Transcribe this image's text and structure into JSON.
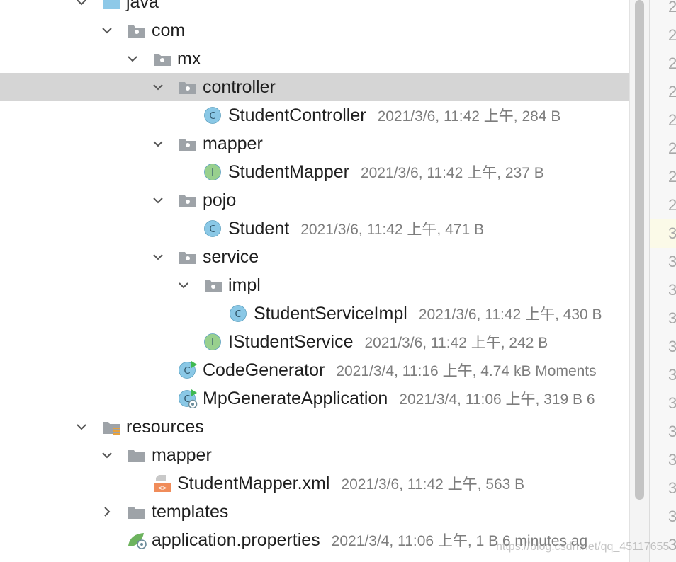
{
  "tree": {
    "rows": [
      {
        "name": "java",
        "meta": "",
        "kind": "folder-src",
        "arrow": "down",
        "depth": 0,
        "selected": false
      },
      {
        "name": "com",
        "meta": "",
        "kind": "package",
        "arrow": "down",
        "depth": 1,
        "selected": false
      },
      {
        "name": "mx",
        "meta": "",
        "kind": "package",
        "arrow": "down",
        "depth": 2,
        "selected": false
      },
      {
        "name": "controller",
        "meta": "",
        "kind": "package",
        "arrow": "down",
        "depth": 3,
        "selected": true
      },
      {
        "name": "StudentController",
        "meta": "2021/3/6, 11:42 上午, 284 B",
        "kind": "class",
        "arrow": "",
        "depth": 4,
        "selected": false
      },
      {
        "name": "mapper",
        "meta": "",
        "kind": "package",
        "arrow": "down",
        "depth": 3,
        "selected": false
      },
      {
        "name": "StudentMapper",
        "meta": "2021/3/6, 11:42 上午, 237 B",
        "kind": "interface",
        "arrow": "",
        "depth": 4,
        "selected": false
      },
      {
        "name": "pojo",
        "meta": "",
        "kind": "package",
        "arrow": "down",
        "depth": 3,
        "selected": false
      },
      {
        "name": "Student",
        "meta": "2021/3/6, 11:42 上午, 471 B",
        "kind": "class",
        "arrow": "",
        "depth": 4,
        "selected": false
      },
      {
        "name": "service",
        "meta": "",
        "kind": "package",
        "arrow": "down",
        "depth": 3,
        "selected": false
      },
      {
        "name": "impl",
        "meta": "",
        "kind": "package",
        "arrow": "down",
        "depth": 4,
        "selected": false
      },
      {
        "name": "StudentServiceImpl",
        "meta": "2021/3/6, 11:42 上午, 430 B",
        "kind": "class",
        "arrow": "",
        "depth": 5,
        "selected": false
      },
      {
        "name": "IStudentService",
        "meta": "2021/3/6, 11:42 上午, 242 B",
        "kind": "interface",
        "arrow": "",
        "depth": 4,
        "selected": false
      },
      {
        "name": "CodeGenerator",
        "meta": "2021/3/4, 11:16 上午, 4.74 kB Moments",
        "kind": "class-run",
        "arrow": "",
        "depth": 3,
        "selected": false
      },
      {
        "name": "MpGenerateApplication",
        "meta": "2021/3/4, 11:06 上午, 319 B 6",
        "kind": "class-spring",
        "arrow": "",
        "depth": 3,
        "selected": false
      },
      {
        "name": "resources",
        "meta": "",
        "kind": "folder-res",
        "arrow": "down",
        "depth": 0,
        "selected": false
      },
      {
        "name": "mapper",
        "meta": "",
        "kind": "folder",
        "arrow": "down",
        "depth": 1,
        "selected": false
      },
      {
        "name": "StudentMapper.xml",
        "meta": "2021/3/6, 11:42 上午, 563 B",
        "kind": "xml",
        "arrow": "",
        "depth": 2,
        "selected": false
      },
      {
        "name": "templates",
        "meta": "",
        "kind": "folder",
        "arrow": "right",
        "depth": 1,
        "selected": false
      },
      {
        "name": "application.properties",
        "meta": "2021/3/4, 11:06 上午, 1 B 6 minutes ag",
        "kind": "properties",
        "arrow": "",
        "depth": 1,
        "selected": false
      }
    ]
  },
  "gutter": {
    "line_numbers": [
      "2",
      "2",
      "2",
      "2",
      "2",
      "2",
      "2",
      "2",
      "3",
      "3",
      "3",
      "3",
      "3",
      "3",
      "3",
      "3",
      "3",
      "3",
      "3",
      "3"
    ],
    "current_index": 8
  },
  "watermark": "https://blog.csdn.net/qq_45117655",
  "colors": {
    "selection": "#d5d5d5",
    "class_icon": "#8ac8e6",
    "interface_icon": "#98d08e",
    "folder_icon": "#9ea3a8",
    "source_folder_icon": "#8ec9e8",
    "run_marker": "#3fb950"
  }
}
